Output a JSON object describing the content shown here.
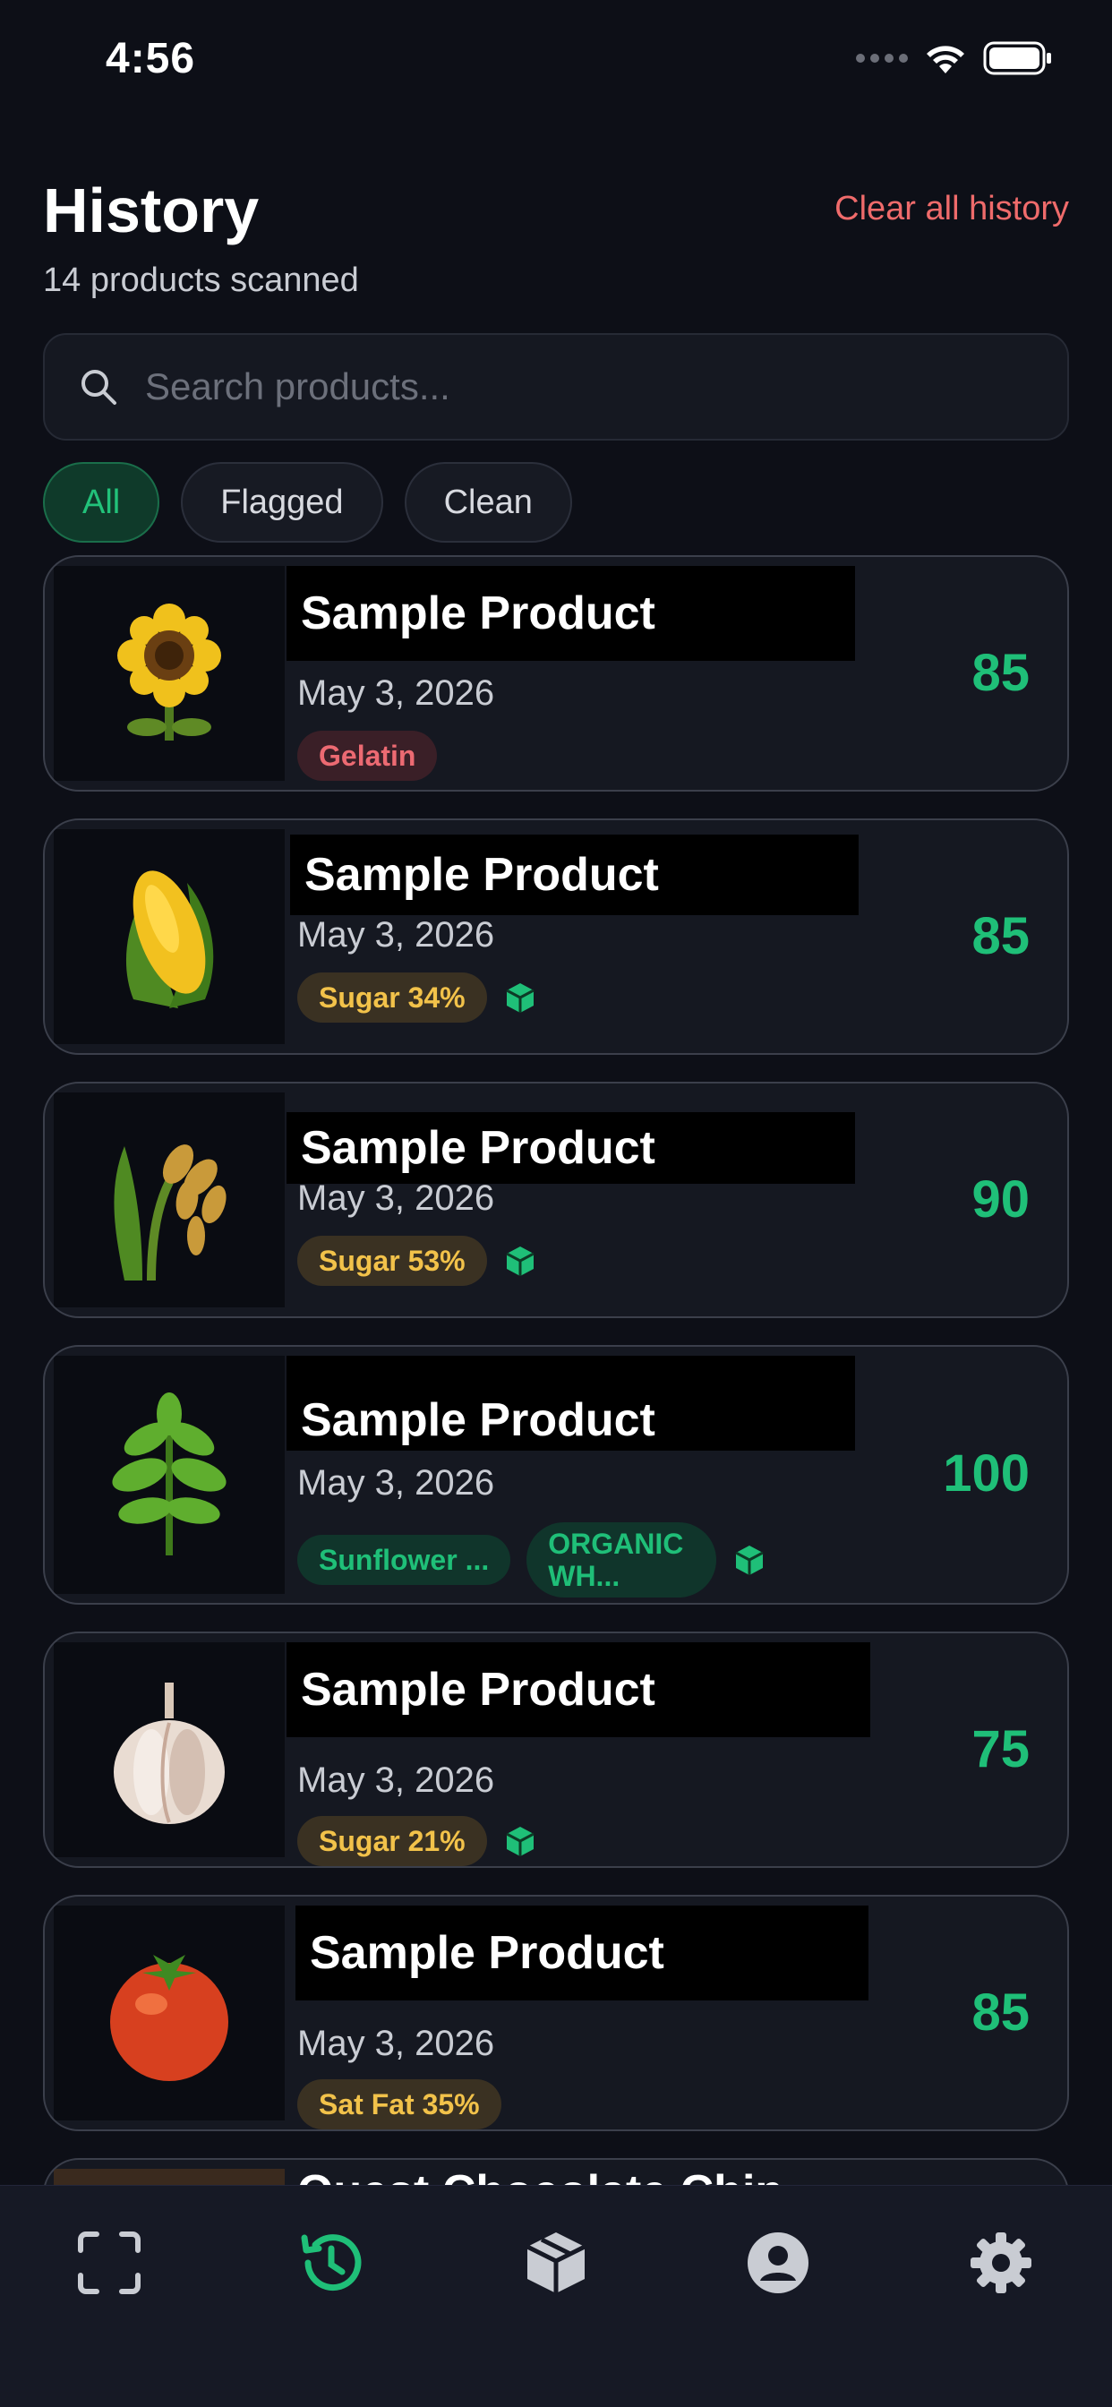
{
  "status": {
    "time": "4:56"
  },
  "header": {
    "title": "History",
    "subtitle": "14 products scanned",
    "clear_label": "Clear all history"
  },
  "search": {
    "placeholder": "Search products..."
  },
  "filters": [
    "All",
    "Flagged",
    "Clean"
  ],
  "active_filter": "All",
  "items": [
    {
      "name": "Sample Product",
      "date": "May 3, 2026",
      "score": "85",
      "thumb": "sunflower",
      "tags": [
        {
          "label": "Gelatin",
          "tone": "red"
        }
      ],
      "box_icon": false
    },
    {
      "name": "Sample Product",
      "date": "May 3, 2026",
      "score": "85",
      "thumb": "corn",
      "tags": [
        {
          "label": "Sugar 34%",
          "tone": "yellow"
        }
      ],
      "box_icon": true
    },
    {
      "name": "Sample Product",
      "date": "May 3, 2026",
      "score": "90",
      "thumb": "wheat",
      "tags": [
        {
          "label": "Sugar 53%",
          "tone": "yellow"
        }
      ],
      "box_icon": true
    },
    {
      "name": "Sample Product",
      "date": "May 3, 2026",
      "score": "100",
      "thumb": "leaf",
      "tags": [
        {
          "label": "Sunflower ...",
          "tone": "green"
        },
        {
          "label": "ORGANIC WH...",
          "tone": "green"
        }
      ],
      "box_icon": true
    },
    {
      "name": "Sample Product",
      "date": "May 3, 2026",
      "score": "75",
      "thumb": "garlic",
      "tags": [
        {
          "label": "Sugar 21%",
          "tone": "yellow"
        }
      ],
      "box_icon": true
    },
    {
      "name": "Sample Product",
      "date": "May 3, 2026",
      "score": "85",
      "thumb": "tomato",
      "tags": [
        {
          "label": "Sat Fat 35%",
          "tone": "yellow"
        }
      ],
      "box_icon": false
    },
    {
      "name": "Quest Chocolate Chip",
      "partial": true
    }
  ],
  "tabs": [
    {
      "icon": "scan-icon",
      "active": false
    },
    {
      "icon": "history-icon",
      "active": true
    },
    {
      "icon": "box-icon",
      "active": false
    },
    {
      "icon": "profile-icon",
      "active": false
    },
    {
      "icon": "settings-icon",
      "active": false
    }
  ],
  "colors": {
    "accent": "#1fbf78",
    "danger": "#ef6b6b",
    "warning": "#f2c24a",
    "background": "#0d0f17"
  }
}
